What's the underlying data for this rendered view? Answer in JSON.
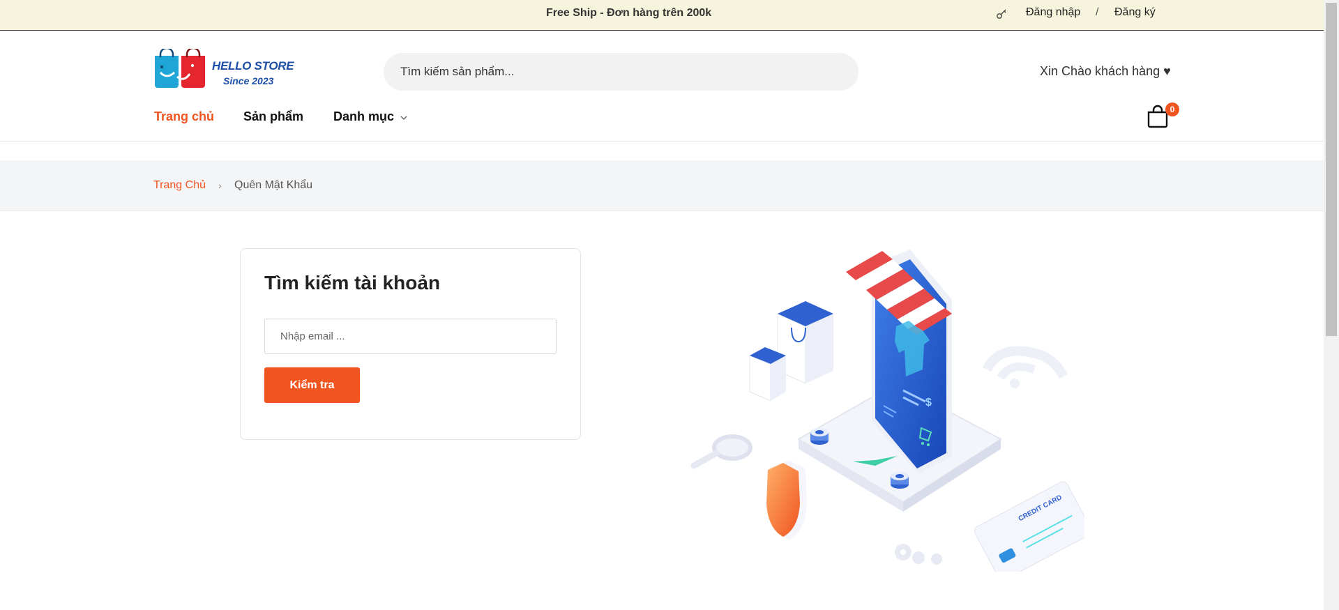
{
  "topbar": {
    "promo": "Free Ship - Đơn hàng trên 200k",
    "login": "Đăng nhập",
    "separator": "/",
    "register": "Đăng ký"
  },
  "header": {
    "logo_line1": "HELLO STORE",
    "logo_line2": "Since 2023",
    "search_placeholder": "Tìm kiếm sản phẩm...",
    "greeting": "Xin Chào khách hàng ♥",
    "cart_count": "0"
  },
  "nav": {
    "home": "Trang chủ",
    "products": "Sản phẩm",
    "category": "Danh mục"
  },
  "breadcrumb": {
    "home": "Trang Chủ",
    "arrow": "›",
    "current": "Quên Mật Khẩu"
  },
  "form": {
    "title": "Tìm kiếm tài khoản",
    "email_placeholder": "Nhập email ...",
    "submit_label": "Kiểm tra"
  },
  "illustration": {
    "card_text": "CREDIT CARD"
  },
  "colors": {
    "accent": "#f0541f",
    "topbar_bg": "#f6f4dc",
    "brand_blue": "#1b4fa6"
  }
}
